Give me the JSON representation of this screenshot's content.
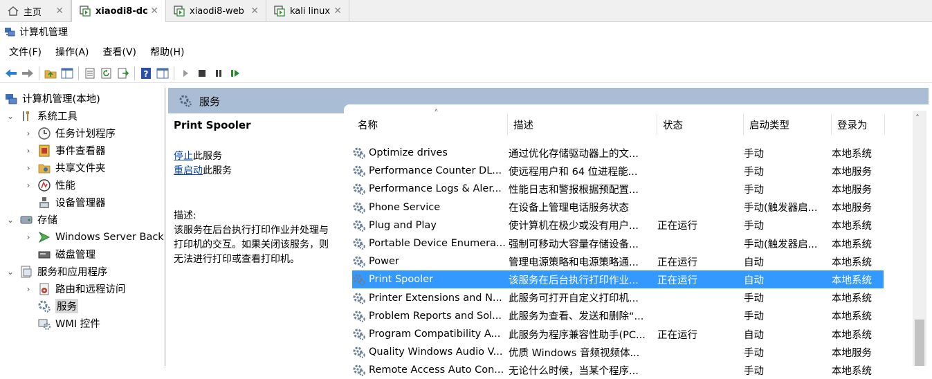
{
  "vm_tabs": [
    {
      "label": "主页",
      "icon": "home-icon",
      "active": false
    },
    {
      "label": "xiaodi8-dc",
      "icon": "vm-icon",
      "active": true
    },
    {
      "label": "xiaodi8-web",
      "icon": "vm-icon",
      "active": false
    },
    {
      "label": "kali linux",
      "icon": "vm-icon",
      "active": false
    }
  ],
  "window": {
    "title": "计算机管理",
    "icon": "computer-management-icon"
  },
  "menu": [
    "文件(F)",
    "操作(A)",
    "查看(V)",
    "帮助(H)"
  ],
  "toolbar": [
    "back-arrow-icon",
    "forward-arrow-icon",
    "up-folder-icon",
    "show-hide-tree-icon",
    "properties-icon",
    "refresh-icon",
    "export-list-icon",
    "help-icon",
    "action-pane-icon",
    "start-service-icon",
    "stop-service-icon",
    "pause-service-icon",
    "restart-service-icon"
  ],
  "tree": {
    "root": "计算机管理(本地)",
    "items": [
      {
        "label": "系统工具",
        "level": 1,
        "expanded": true,
        "icon": "system-tools-icon"
      },
      {
        "label": "任务计划程序",
        "level": 2,
        "expanded": false,
        "icon": "task-scheduler-icon"
      },
      {
        "label": "事件查看器",
        "level": 2,
        "expanded": false,
        "icon": "event-viewer-icon"
      },
      {
        "label": "共享文件夹",
        "level": 2,
        "expanded": false,
        "icon": "shared-folders-icon"
      },
      {
        "label": "性能",
        "level": 2,
        "expanded": false,
        "icon": "performance-icon"
      },
      {
        "label": "设备管理器",
        "level": 2,
        "expanded": null,
        "icon": "device-manager-icon"
      },
      {
        "label": "存储",
        "level": 1,
        "expanded": true,
        "icon": "storage-icon"
      },
      {
        "label": "Windows Server Back",
        "level": 2,
        "expanded": false,
        "icon": "windows-backup-icon"
      },
      {
        "label": "磁盘管理",
        "level": 2,
        "expanded": null,
        "icon": "disk-management-icon"
      },
      {
        "label": "服务和应用程序",
        "level": 1,
        "expanded": true,
        "icon": "services-apps-icon"
      },
      {
        "label": "路由和远程访问",
        "level": 2,
        "expanded": false,
        "icon": "routing-icon"
      },
      {
        "label": "服务",
        "level": 2,
        "expanded": null,
        "icon": "services-icon",
        "selected": true
      },
      {
        "label": "WMI 控件",
        "level": 2,
        "expanded": null,
        "icon": "wmi-icon"
      }
    ]
  },
  "services_header": "服务",
  "detail": {
    "name": "Print Spooler",
    "stop_link": "停止",
    "stop_suffix": "此服务",
    "restart_link": "重启动",
    "restart_suffix": "此服务",
    "desc_label": "描述:",
    "desc_lines": [
      "该服务在后台执行打印作业并处理与",
      "打印机的交互。如果关闭该服务，则",
      "无法进行打印或查看打印机。"
    ]
  },
  "columns": [
    "名称",
    "描述",
    "状态",
    "启动类型",
    "登录为"
  ],
  "rows": [
    {
      "name": "Optimize drives",
      "desc": "通过优化存储驱动器上的文...",
      "status": "",
      "startup": "手动",
      "logon": "本地系统"
    },
    {
      "name": "Performance Counter DL...",
      "desc": "使远程用户和 64 位进程能...",
      "status": "",
      "startup": "手动",
      "logon": "本地服务"
    },
    {
      "name": "Performance Logs & Aler...",
      "desc": "性能日志和警报根据预配置...",
      "status": "",
      "startup": "手动",
      "logon": "本地服务"
    },
    {
      "name": "Phone Service",
      "desc": "在设备上管理电话服务状态",
      "status": "",
      "startup": "手动(触发器启...",
      "logon": "本地服务"
    },
    {
      "name": "Plug and Play",
      "desc": "使计算机在极少或没有用户...",
      "status": "正在运行",
      "startup": "手动",
      "logon": "本地系统"
    },
    {
      "name": "Portable Device Enumera...",
      "desc": "强制可移动大容量存储设备...",
      "status": "",
      "startup": "手动(触发器启...",
      "logon": "本地系统"
    },
    {
      "name": "Power",
      "desc": "管理电源策略和电源策略通...",
      "status": "正在运行",
      "startup": "自动",
      "logon": "本地系统"
    },
    {
      "name": "Print Spooler",
      "desc": "该服务在后台执行打印作业...",
      "status": "正在运行",
      "startup": "自动",
      "logon": "本地系统",
      "selected": true
    },
    {
      "name": "Printer Extensions and N...",
      "desc": "此服务可打开自定义打印机...",
      "status": "",
      "startup": "手动",
      "logon": "本地系统"
    },
    {
      "name": "Problem Reports and Sol...",
      "desc": "此服务为查看、发送和删除“...",
      "status": "",
      "startup": "手动",
      "logon": "本地系统"
    },
    {
      "name": "Program Compatibility A...",
      "desc": "此服务为程序兼容性助手(PC...",
      "status": "正在运行",
      "startup": "自动",
      "logon": "本地系统"
    },
    {
      "name": "Quality Windows Audio V...",
      "desc": "优质 Windows 音频视频体...",
      "status": "",
      "startup": "手动",
      "logon": "本地服务"
    },
    {
      "name": "Remote Access Auto Con...",
      "desc": "无论什么时候，当某个程序...",
      "status": "",
      "startup": "手动",
      "logon": "本地系统"
    }
  ],
  "colors": {
    "header_band": "#a9bdd4",
    "selection": "#3399ff",
    "link": "#0645ad"
  }
}
